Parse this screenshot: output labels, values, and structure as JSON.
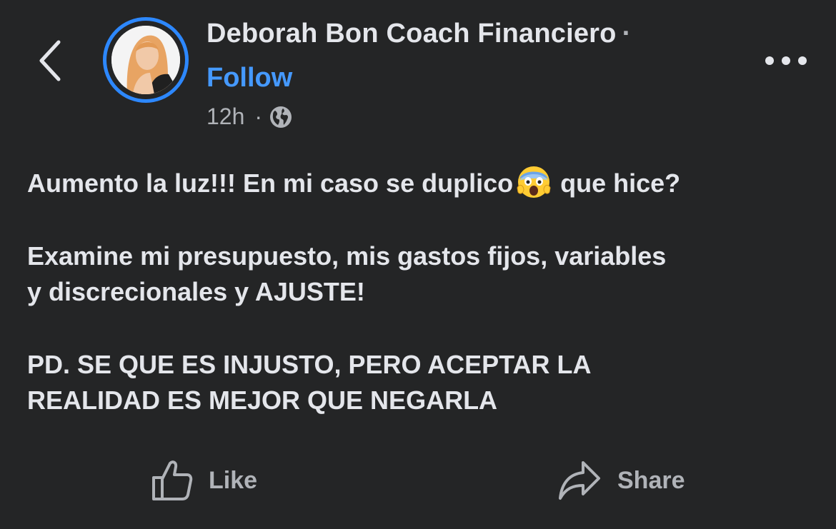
{
  "post": {
    "author": "Deborah Bon Coach Financiero",
    "separator": "·",
    "follow_label": "Follow",
    "timestamp": "12h",
    "meta_separator": "·",
    "audience_icon": "globe-icon",
    "lines": {
      "p1_before": "Aumento la luz!!! En mi caso se duplico",
      "p1_emoji": "screaming-face-emoji",
      "p1_after": " que hice?",
      "p2_l1": "Examine mi presupuesto, mis gastos fijos, variables",
      "p2_l2": "y discrecionales y AJUSTE!",
      "p3_l1": "PD. SE QUE ES INJUSTO, PERO ACEPTAR LA",
      "p3_l2": "REALIDAD ES MEJOR QUE NEGARLA"
    }
  },
  "nav": {
    "back_icon": "chevron-left-icon",
    "more_icon": "more-horizontal-icon"
  },
  "actions": {
    "like_label": "Like",
    "like_icon": "thumbs-up-icon",
    "share_label": "Share",
    "share_icon": "share-arrow-icon"
  },
  "colors": {
    "background": "#242526",
    "text": "#e4e6eb",
    "secondary": "#b0b3b8",
    "accent": "#4599ff",
    "avatar_ring": "#2d88ff"
  }
}
